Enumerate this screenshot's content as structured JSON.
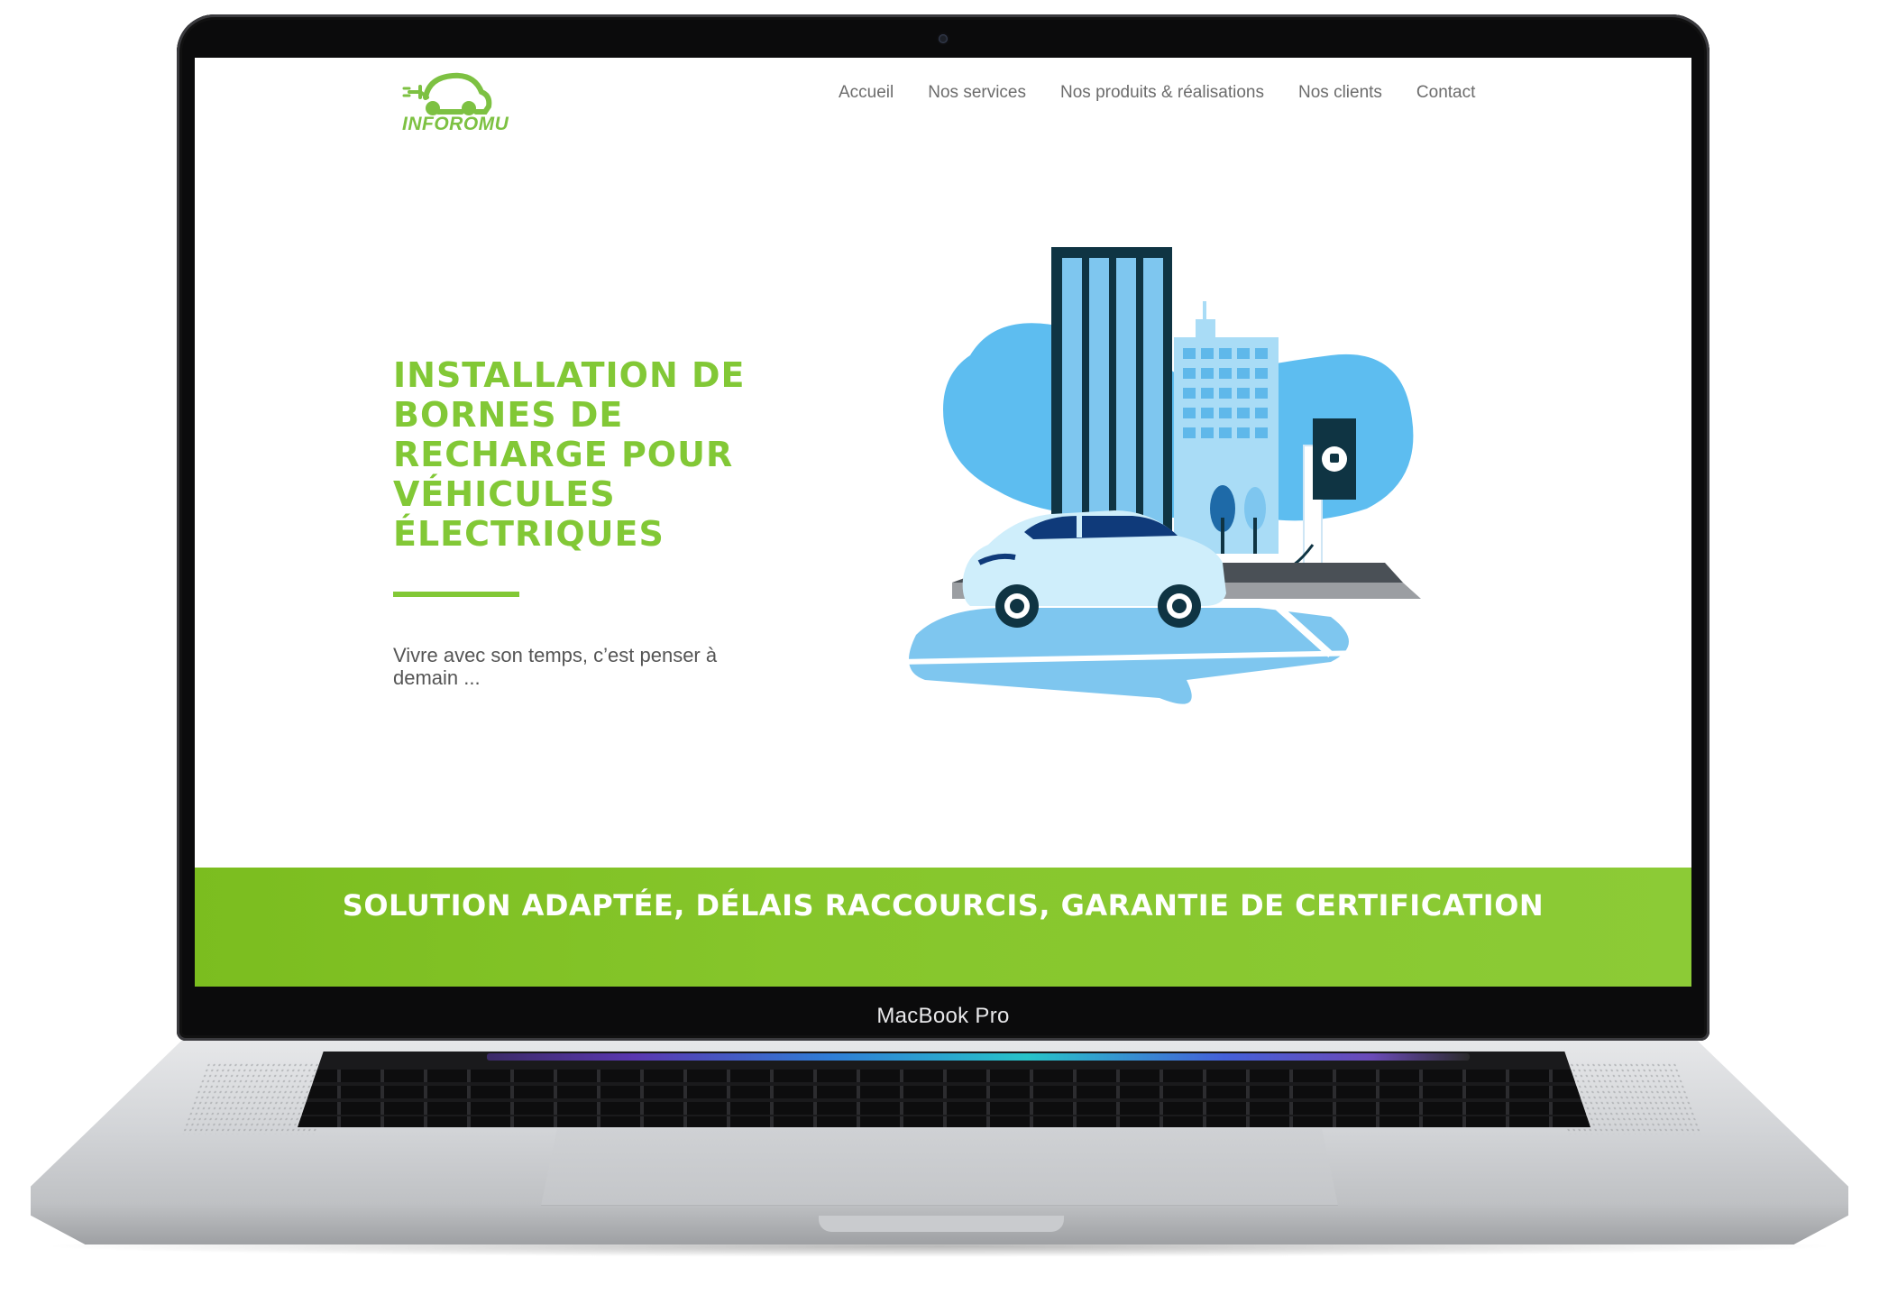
{
  "device": {
    "label": "MacBook Pro"
  },
  "site": {
    "logo_text": "INFOROMU",
    "brand_color": "#82c836",
    "nav": [
      {
        "label": "Accueil"
      },
      {
        "label": "Nos services"
      },
      {
        "label": "Nos produits & réalisations"
      },
      {
        "label": "Nos clients"
      },
      {
        "label": "Contact"
      }
    ]
  },
  "hero": {
    "title": "INSTALLATION DE BORNES DE RECHARGE POUR VÉHICULES ÉLECTRIQUES",
    "tagline": "Vivre avec son temps, c’est penser à demain ...",
    "illustration_icon": "electric-car-charging-city-illustration"
  },
  "band": {
    "title": "SOLUTION ADAPTÉE, DÉLAIS RACCOURCIS, GARANTIE DE CERTIFICATION",
    "color": "#82c836"
  }
}
